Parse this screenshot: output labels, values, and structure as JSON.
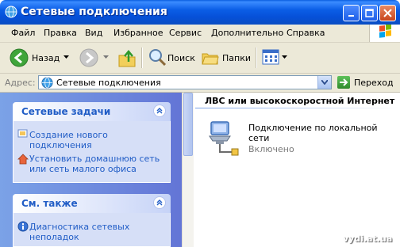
{
  "window": {
    "title": "Сетевые подключения"
  },
  "menu": {
    "items": [
      "Файл",
      "Правка",
      "Вид",
      "Избранное",
      "Сервис",
      "Дополнительно",
      "Справка"
    ]
  },
  "toolbar": {
    "back_label": "Назад",
    "search_label": "Поиск",
    "folders_label": "Папки"
  },
  "address": {
    "label": "Адрес:",
    "value": "Сетевые подключения",
    "go_label": "Переход"
  },
  "tasks_panel": {
    "title": "Сетевые задачи",
    "items": [
      "Создание нового подключения",
      "Установить домашнюю сеть или сеть малого офиса"
    ]
  },
  "see_also_panel": {
    "title": "См. также",
    "items": [
      "Диагностика сетевых неполадок"
    ]
  },
  "content": {
    "group_header": "ЛВС или высокоскоростной Интернет",
    "connection": {
      "name": "Подключение по локальной сети",
      "status": "Включено"
    }
  },
  "watermark": "vydi.at.ua"
}
